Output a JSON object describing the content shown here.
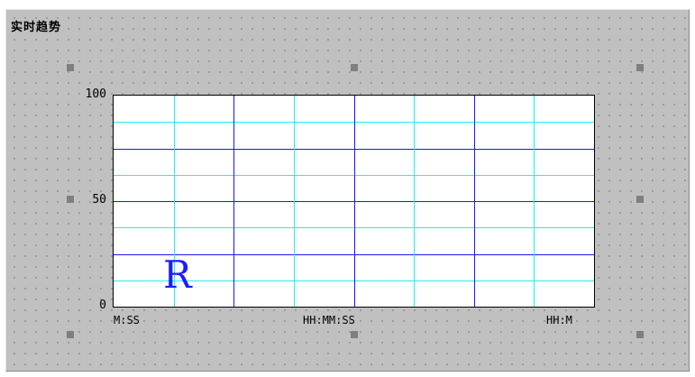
{
  "panel": {
    "title": "实时趋势"
  },
  "trend": {
    "y_ticks": [
      "100",
      "50",
      "0"
    ],
    "x_ticks": [
      "M:SS",
      "HH:MM:SS",
      "HH:M"
    ],
    "marker_letter": "R",
    "colors": {
      "major_grid": "#1818ff",
      "minor_grid": "#1ff0f0",
      "marker": "#1c1cff",
      "panel": "#c0c0c0",
      "handle": "#7f7f7f"
    }
  },
  "chart_data": {
    "type": "line",
    "title": "实时趋势",
    "ylim": [
      0,
      100
    ],
    "y_ticks": [
      0,
      50,
      100
    ],
    "x_tick_labels": [
      "M:SS",
      "HH:MM:SS",
      "HH:M"
    ],
    "series": [],
    "grid": true
  }
}
